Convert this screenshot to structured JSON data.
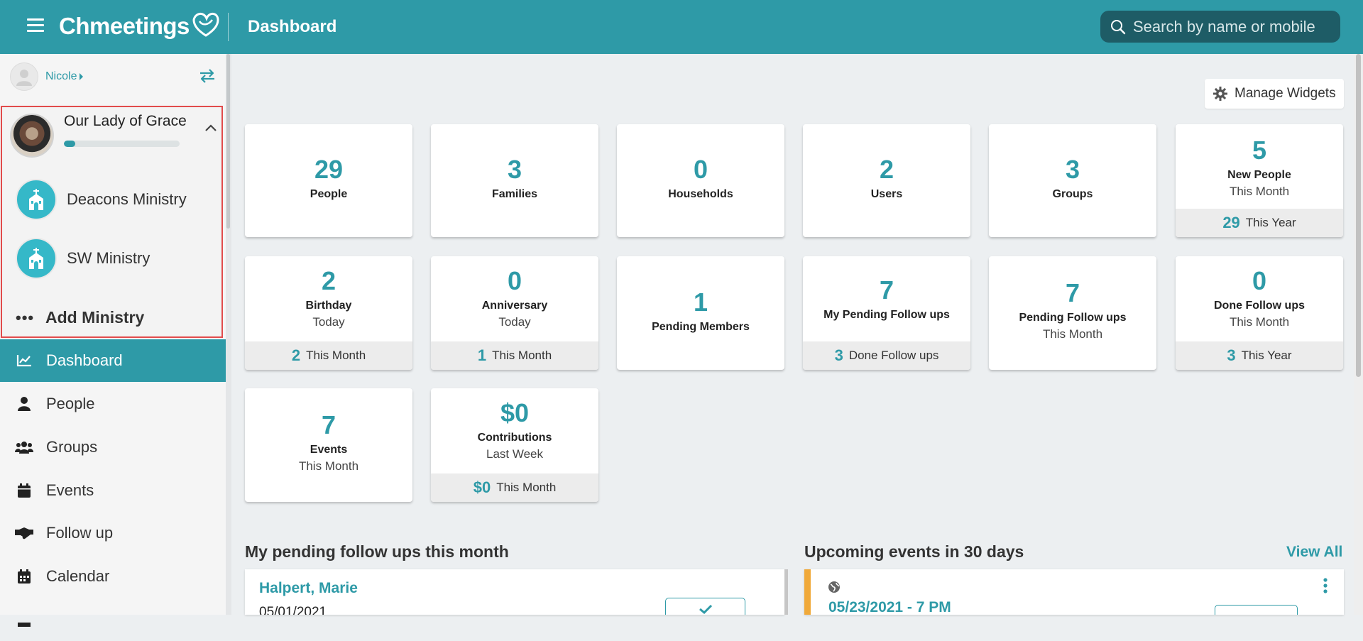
{
  "header": {
    "logo_text": "Chmeetings",
    "page_title": "Dashboard",
    "search_placeholder": "Search by name or mobile"
  },
  "sidebar": {
    "user_name": "Nicole",
    "church": {
      "name": "Our Lady of Grace",
      "progress_fraction": 0.1
    },
    "ministries": [
      {
        "label": "Deacons Ministry"
      },
      {
        "label": "SW Ministry"
      }
    ],
    "add_ministry_dots": "•••",
    "add_ministry_label": "Add Ministry",
    "nav": [
      {
        "label": "Dashboard",
        "icon": "chart-line-icon",
        "active": true
      },
      {
        "label": "People",
        "icon": "person-icon"
      },
      {
        "label": "Groups",
        "icon": "users-icon"
      },
      {
        "label": "Events",
        "icon": "calendar-icon"
      },
      {
        "label": "Follow up",
        "icon": "handshake-icon"
      },
      {
        "label": "Calendar",
        "icon": "calendar-grid-icon"
      }
    ]
  },
  "toolbar": {
    "manage_widgets": "Manage Widgets"
  },
  "widgets": {
    "people": {
      "num": "29",
      "label": "People"
    },
    "families": {
      "num": "3",
      "label": "Families"
    },
    "households": {
      "num": "0",
      "label": "Households"
    },
    "users": {
      "num": "2",
      "label": "Users"
    },
    "groups": {
      "num": "3",
      "label": "Groups"
    },
    "new_people": {
      "num": "5",
      "label": "New People",
      "sub": "This Month",
      "foot_num": "29",
      "foot_text": "This Year"
    },
    "birthday": {
      "num": "2",
      "label": "Birthday",
      "sub": "Today",
      "foot_num": "2",
      "foot_text": "This Month"
    },
    "anniversary": {
      "num": "0",
      "label": "Anniversary",
      "sub": "Today",
      "foot_num": "1",
      "foot_text": "This Month"
    },
    "pending_members": {
      "num": "1",
      "label": "Pending Members"
    },
    "my_pending_followups": {
      "num": "7",
      "label": "My Pending Follow ups",
      "foot_num": "3",
      "foot_text": "Done Follow ups"
    },
    "pending_followups": {
      "num": "7",
      "label": "Pending Follow ups",
      "sub": "This Month"
    },
    "done_followups": {
      "num": "0",
      "label": "Done Follow ups",
      "sub": "This Month",
      "foot_num": "3",
      "foot_text": "This Year"
    },
    "events": {
      "num": "7",
      "label": "Events",
      "sub": "This Month"
    },
    "contributions": {
      "num": "$0",
      "label": "Contributions",
      "sub": "Last Week",
      "foot_num": "$0",
      "foot_text": "This Month"
    }
  },
  "followups": {
    "title": "My pending follow ups this month",
    "item": {
      "name": "Halpert, Marie",
      "date": "05/01/2021"
    }
  },
  "events_section": {
    "title": "Upcoming events in 30 days",
    "view_all": "View All",
    "item": {
      "date": "05/23/2021 - 7 PM"
    }
  },
  "colors": {
    "brand": "#2e9aa7",
    "search_bg": "#1e5c66",
    "highlight_border": "#e14b4b",
    "event_accent": "#f0a93a"
  }
}
